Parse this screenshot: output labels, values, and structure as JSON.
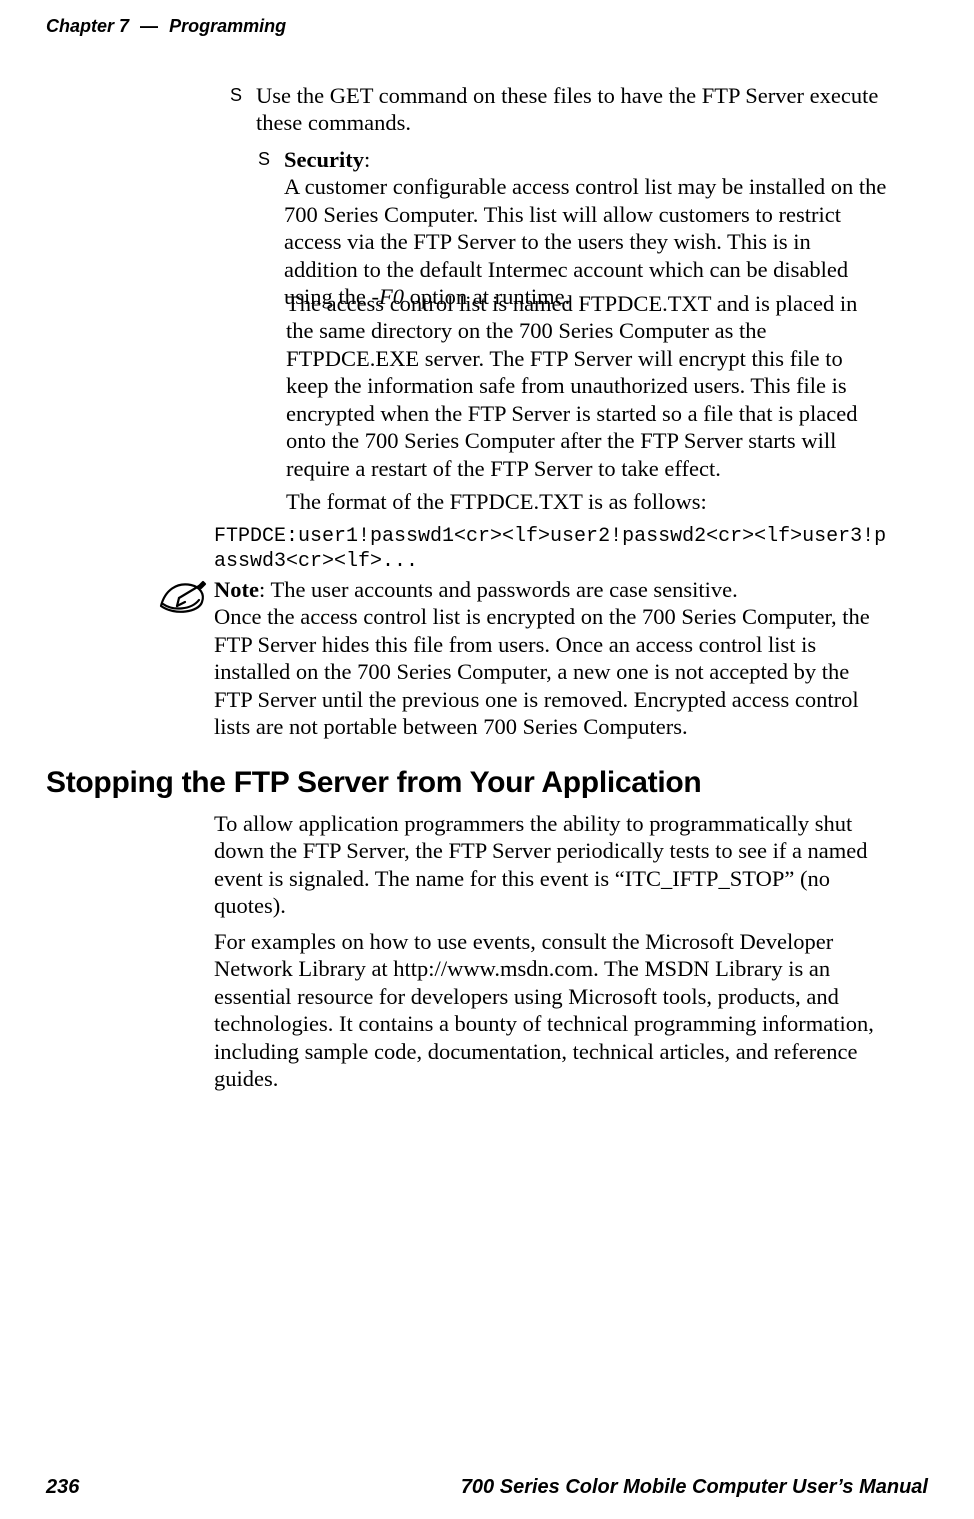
{
  "running_head": {
    "chapter": "Chapter 7",
    "sep": "—",
    "title": "Programming"
  },
  "bullets": {
    "b1_marker": "S",
    "b1_text": "Use the GET command on these files to have the FTP Server execute these commands.",
    "b2_marker": "S",
    "b2_label": "Security",
    "b2_text_after_label": ":",
    "b2_para": "A customer configurable access control list may be installed on the 700 Series Computer. This list will allow customers to restrict access via the FTP Server to the users they wish. This is in addition to the default Intermec account which can be disabled using the ",
    "b2_opt": "-F0",
    "b2_para_tail": " option at runtime.",
    "b3_para": "The access control list is named FTPDCE.TXT and is placed in the same directory on the 700 Series Computer as the FTPDCE.EXE server. The FTP Server will encrypt this file to keep the information safe from unauthorized users. This file is encrypted when the FTP Server is started so a file that is placed onto the 700 Series Computer after the FTP Server starts will require a restart of the FTP Server to take effect.",
    "b4_para": "The format of the FTPDCE.TXT is as follows:"
  },
  "code_block": "FTPDCE:user1!passwd1<cr><lf>user2!passwd2<cr><lf>user3!passwd3<cr><lf>...",
  "note": {
    "lead": "Note",
    "after_lead": ": The user accounts and passwords are case sensitive.",
    "body": "Once the access control list is encrypted on the 700 Series Computer, the FTP Server hides this file from users. Once an access control list is installed on the 700 Series Computer, a new one is not accepted by the FTP Server until the previous one is removed. Encrypted access control lists are not portable between 700 Series Computers."
  },
  "h2": "Stopping the FTP Server from Your Application",
  "para1": "To allow application programmers the ability to programmatically shut down the FTP Server, the FTP Server periodically tests to see if a named event is signaled. The name for this event is “ITC_IFTP_STOP” (no quotes).",
  "para2": "For examples on how to use events, consult the Microsoft Developer Network Library at http://www.msdn.com. The MSDN Library is an essential resource for developers using Microsoft tools, products, and technologies. It contains a bounty of technical programming information, including sample code, documentation, technical articles, and reference guides.",
  "footer": {
    "page": "236",
    "title": "700 Series Color Mobile Computer User’s Manual"
  }
}
